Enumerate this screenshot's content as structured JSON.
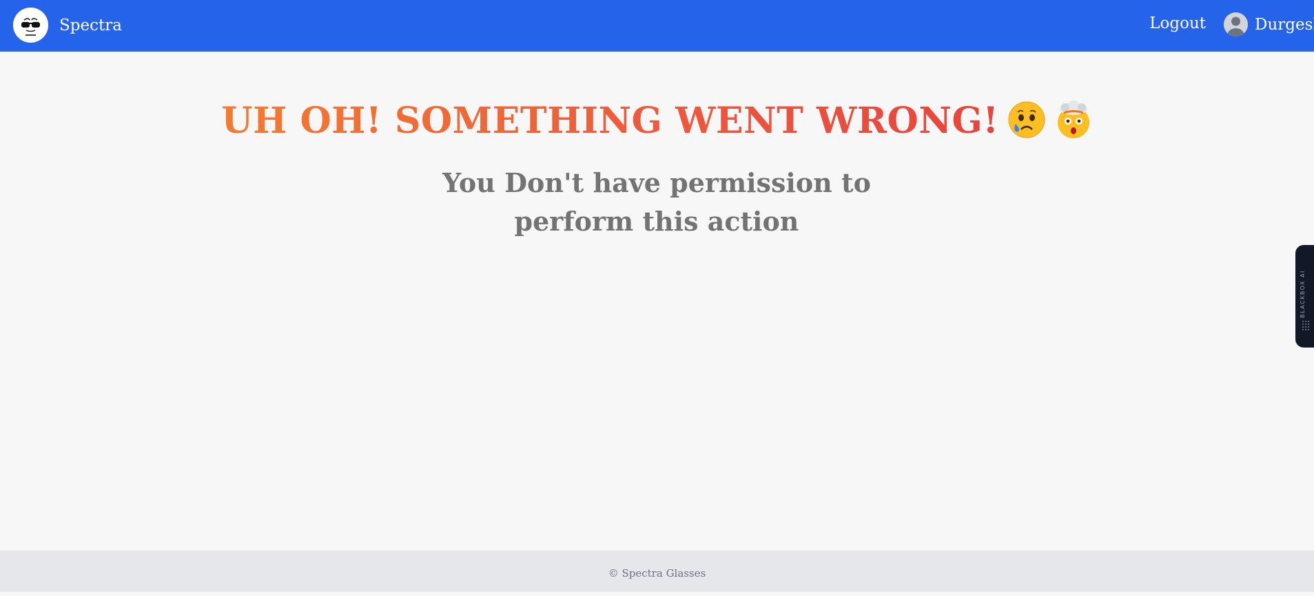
{
  "navbar": {
    "brand_name": "Spectra",
    "logout_label": "Logout",
    "user_name": "Durgesh",
    "bg_color": "#2563eb"
  },
  "error": {
    "heading": "UH OH! SOMETHING WENT WRONG!",
    "emojis": [
      "sad-relieved-face",
      "exploding-head"
    ],
    "message": "You Don't have permission to perform this action"
  },
  "side_tab": {
    "label": "BLACKBOX AI"
  },
  "footer": {
    "text": "© Spectra Glasses"
  }
}
